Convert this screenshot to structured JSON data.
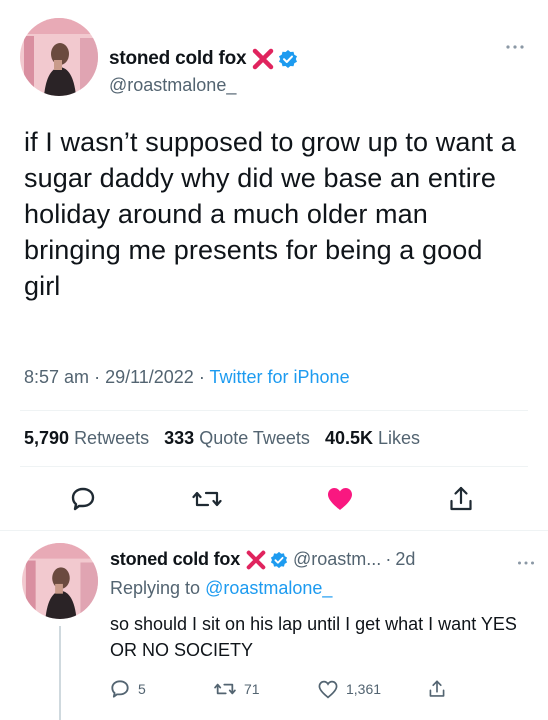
{
  "main_tweet": {
    "display_name": "stoned cold fox",
    "handle": "@roastmalone_",
    "text": "if I wasn’t supposed to grow up to want a sugar daddy why did we base an entire holiday around a much older man bringing me presents for being a good girl",
    "time": "8:57 am",
    "date": "29/11/2022",
    "source": "Twitter for iPhone",
    "stats": {
      "retweets_count": "5,790",
      "retweets_label": "Retweets",
      "quotes_count": "333",
      "quotes_label": "Quote Tweets",
      "likes_count": "40.5K",
      "likes_label": "Likes"
    }
  },
  "reply_tweet": {
    "display_name": "stoned cold fox",
    "handle": "@roastm...",
    "time": "2d",
    "replying_label": "Replying to",
    "replying_to": "@roastmalone_",
    "text": "so should I sit on his lap until I get what I want YES OR NO SOCIETY",
    "counts": {
      "replies": "5",
      "retweets": "71",
      "likes": "1,361"
    }
  },
  "colors": {
    "text": "#0f1419",
    "secondary": "#536471",
    "link": "#1d9bf0",
    "liked": "#f91880",
    "x_mark": "#e0245e",
    "verified": "#1d9bf0"
  },
  "icons": {
    "reply": "speech-bubble-icon",
    "retweet": "retweet-arrows-icon",
    "like": "heart-icon",
    "share": "share-arrow-icon",
    "more": "ellipsis-icon",
    "verified": "verified-badge-icon",
    "x": "red-x-icon"
  }
}
